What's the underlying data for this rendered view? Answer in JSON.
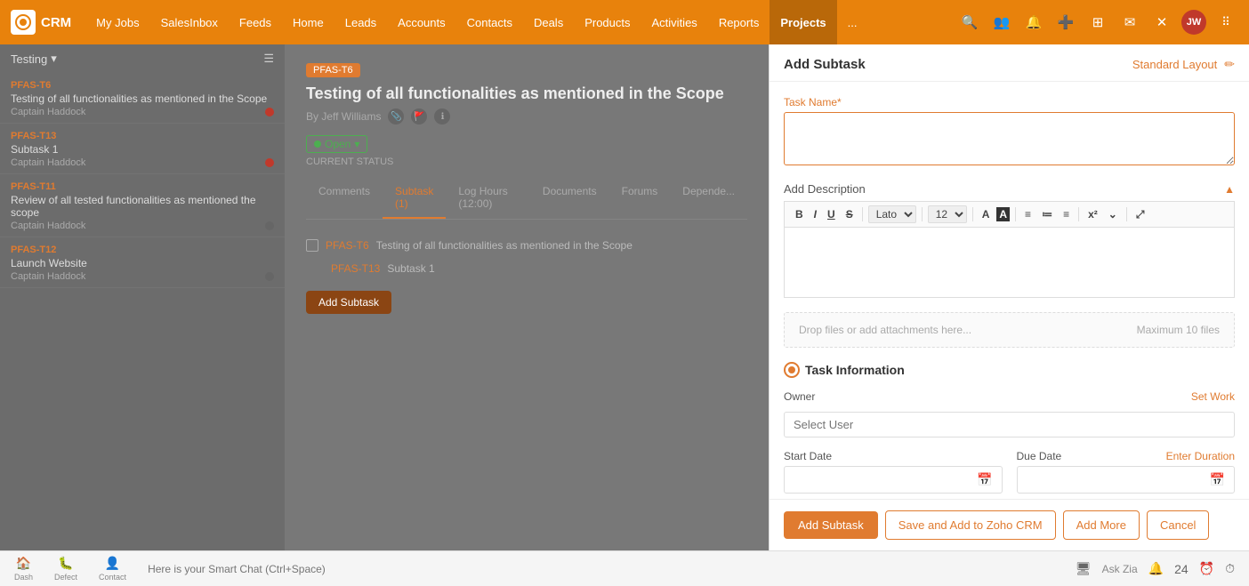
{
  "app": {
    "name": "CRM",
    "logo_text": "CRM"
  },
  "topnav": {
    "items": [
      {
        "label": "My Jobs",
        "active": false
      },
      {
        "label": "SalesInbox",
        "active": false
      },
      {
        "label": "Feeds",
        "active": false
      },
      {
        "label": "Home",
        "active": false
      },
      {
        "label": "Leads",
        "active": false
      },
      {
        "label": "Accounts",
        "active": false
      },
      {
        "label": "Contacts",
        "active": false
      },
      {
        "label": "Deals",
        "active": false
      },
      {
        "label": "Products",
        "active": false
      },
      {
        "label": "Activities",
        "active": false
      },
      {
        "label": "Reports",
        "active": false
      },
      {
        "label": "Projects",
        "active": true
      },
      {
        "label": "...",
        "active": false
      }
    ]
  },
  "sidebar": {
    "header": "Testing",
    "tasks": [
      {
        "id": "PFAS-T6",
        "title": "Testing of all functionalities as mentioned in the Scope",
        "assignee": "Captain Haddock",
        "dot_color": "red"
      },
      {
        "id": "PFAS-T13",
        "title": "Subtask 1",
        "assignee": "Captain Haddock",
        "dot_color": "red"
      },
      {
        "id": "PFAS-T11",
        "title": "Review of all tested functionalities as mentioned the scope",
        "assignee": "Captain Haddock",
        "dot_color": "gray"
      },
      {
        "id": "PFAS-T12",
        "title": "Launch Website",
        "assignee": "Captain Haddock",
        "dot_color": "gray"
      }
    ]
  },
  "content": {
    "badge": "PFAS-T6",
    "title": "Testing of all functionalities as mentioned in the Scope",
    "author": "By Jeff Williams",
    "status": "Open",
    "current_status_label": "CURRENT STATUS",
    "tabs": [
      {
        "label": "Comments",
        "active": false
      },
      {
        "label": "Subtask (1)",
        "active": true
      },
      {
        "label": "Log Hours (12:00)",
        "active": false
      },
      {
        "label": "Documents",
        "active": false
      },
      {
        "label": "Forums",
        "active": false
      },
      {
        "label": "Depende...",
        "active": false
      }
    ],
    "subtasks": [
      {
        "id": "PFAS-T6",
        "title": "Testing of all functionalities as mentioned in the Scope"
      },
      {
        "id": "PFAS-T13",
        "title": "Subtask 1"
      }
    ],
    "add_subtask_btn": "Add Subtask"
  },
  "panel": {
    "title": "Add Subtask",
    "standard_layout": "Standard Layout",
    "edit_icon": "✏",
    "task_name_label": "Task Name",
    "task_name_required": "*",
    "task_name_placeholder": "",
    "add_description_label": "Add Description",
    "toolbar": {
      "bold": "B",
      "italic": "I",
      "underline": "U",
      "strike": "S",
      "font": "Lato",
      "size": "12",
      "align": "≡",
      "list": "≔",
      "indent": "≡",
      "superscript": "x²",
      "expand": "⤢"
    },
    "file_drop_label": "Drop files or add attachments here...",
    "file_drop_max": "Maximum 10 files",
    "task_info_title": "Task Information",
    "owner_label": "Owner",
    "set_work_label": "Set Work",
    "select_user_placeholder": "Select User",
    "start_date_label": "Start Date",
    "due_date_label": "Due Date",
    "enter_duration_label": "Enter Duration",
    "buttons": {
      "add_subtask": "Add Subtask",
      "save_crm": "Save and Add to Zoho CRM",
      "add_more": "Add More",
      "cancel": "Cancel"
    }
  },
  "bottom_bar": {
    "items": [
      {
        "icon": "🏠",
        "label": "Dash"
      },
      {
        "icon": "🐛",
        "label": "Defect"
      },
      {
        "icon": "👤",
        "label": "Contact"
      }
    ],
    "chat_placeholder": "Here is your Smart Chat (Ctrl+Space)",
    "right_icons": [
      "🖥",
      "Ask Zia",
      "🔔",
      "24",
      "⏰",
      "⏱"
    ]
  }
}
